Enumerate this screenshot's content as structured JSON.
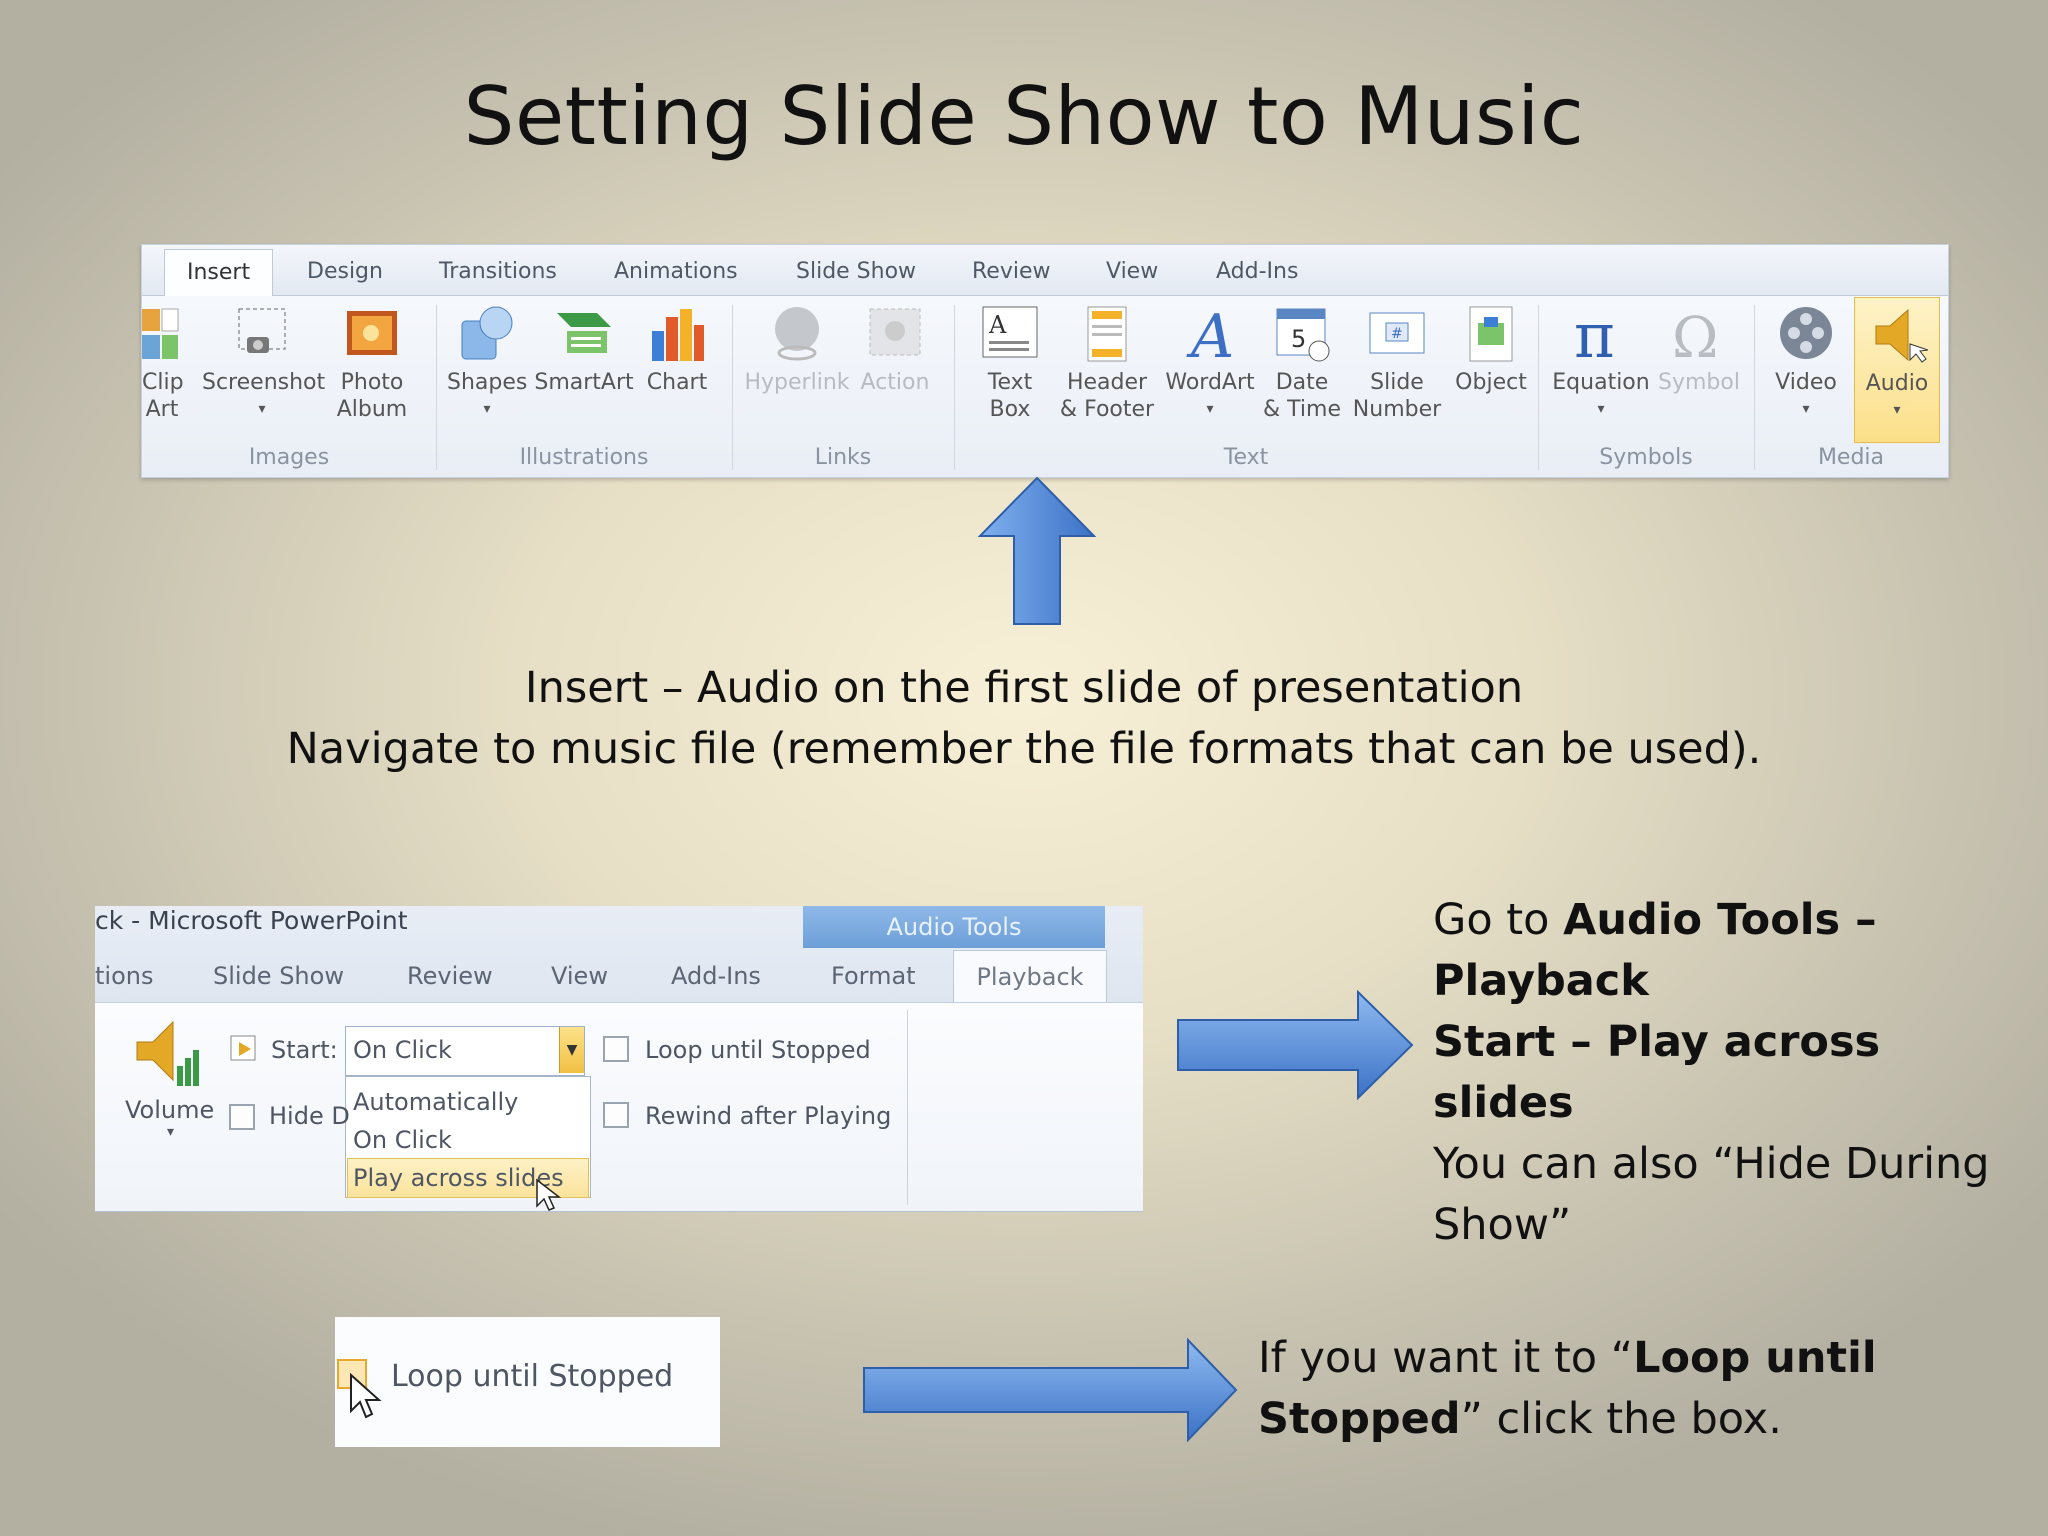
{
  "slide": {
    "title": "Setting Slide Show to Music",
    "instruction_line1": "Insert – Audio on the first slide of presentation",
    "instruction_line2": "Navigate to music file (remember the file formats that can be used).",
    "step2": {
      "part1": "Go to ",
      "bold1": "Audio Tools – Playback",
      "bold2": "Start – Play across slides",
      "part2": "You can also “Hide During Show”"
    },
    "step3": {
      "part1": "If you want it to “",
      "bold": "Loop until Stopped",
      "part2": "” click the box."
    }
  },
  "ribbon": {
    "tabs": [
      "Insert",
      "Design",
      "Transitions",
      "Animations",
      "Slide Show",
      "Review",
      "View",
      "Add-Ins"
    ],
    "buttons": {
      "clip_art": [
        "Clip",
        "Art"
      ],
      "screenshot": "Screenshot",
      "photo_album": [
        "Photo",
        "Album"
      ],
      "shapes": "Shapes",
      "smartart": "SmartArt",
      "chart": "Chart",
      "hyperlink": "Hyperlink",
      "action": "Action",
      "text_box": [
        "Text",
        "Box"
      ],
      "header_footer": [
        "Header",
        "& Footer"
      ],
      "wordart": "WordArt",
      "date_time": [
        "Date",
        "& Time"
      ],
      "slide_number": [
        "Slide",
        "Number"
      ],
      "object": "Object",
      "equation": "Equation",
      "symbol": "Symbol",
      "video": "Video",
      "audio": "Audio"
    },
    "groups": [
      "Images",
      "Illustrations",
      "Links",
      "Text",
      "Symbols",
      "Media"
    ],
    "accent": "#f5c242"
  },
  "playback": {
    "window_title": "ck - Microsoft PowerPoint",
    "contextual_label": "Audio Tools",
    "tabs": [
      "tions",
      "Slide Show",
      "Review",
      "View",
      "Add-Ins",
      "Format"
    ],
    "active_tab": "Playback",
    "volume_label": "Volume",
    "hide_label": "Hide D",
    "start_label": "Start:",
    "start_value": "On Click",
    "options": [
      "Automatically",
      "On Click",
      "Play across slides"
    ],
    "loop_label": "Loop until Stopped",
    "rewind_label": "Rewind after Playing"
  },
  "loop_crop": {
    "label": "Loop until Stopped"
  }
}
